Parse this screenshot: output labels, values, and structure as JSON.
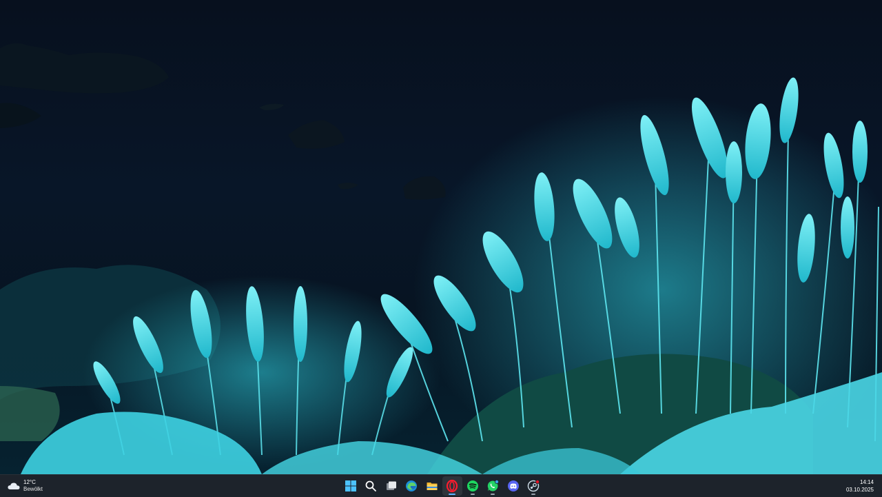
{
  "weather": {
    "temperature": "12°C",
    "condition": "Bewölkt",
    "icon": "cloud-icon"
  },
  "taskbar": {
    "apps": [
      {
        "name": "start",
        "icon": "windows-logo-icon",
        "running": false
      },
      {
        "name": "search",
        "icon": "search-icon",
        "running": false
      },
      {
        "name": "task-view",
        "icon": "task-view-icon",
        "running": false
      },
      {
        "name": "edge",
        "icon": "edge-icon",
        "running": false
      },
      {
        "name": "file-explorer",
        "icon": "folder-icon",
        "running": false
      },
      {
        "name": "opera",
        "icon": "opera-icon",
        "running": true,
        "active": true
      },
      {
        "name": "spotify",
        "icon": "spotify-icon",
        "running": true
      },
      {
        "name": "whatsapp",
        "icon": "whatsapp-icon",
        "running": true,
        "badge": true
      },
      {
        "name": "discord",
        "icon": "discord-icon",
        "running": false
      },
      {
        "name": "steam",
        "icon": "steam-icon",
        "running": true,
        "badge": true
      }
    ]
  },
  "clock": {
    "time": "14:14",
    "date": "03.10.2025"
  },
  "colors": {
    "taskbar_bg": "#1e242c",
    "accent": "#5fb2ff",
    "grass": "#39d4e4"
  }
}
